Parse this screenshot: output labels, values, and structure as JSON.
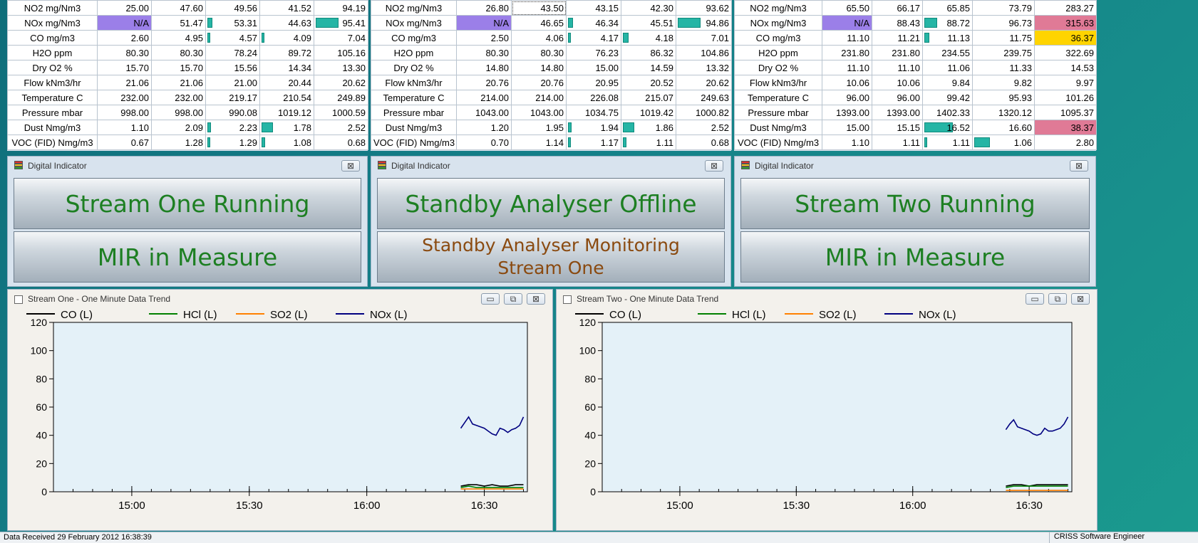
{
  "tables": [
    {
      "rows": [
        {
          "label": "NO2 mg/Nm3",
          "values": [
            "25.00",
            "47.60",
            "49.56",
            "41.52",
            "94.19"
          ]
        },
        {
          "label": "NOx mg/Nm3",
          "values": [
            "N/A",
            "51.47",
            "53.31",
            "44.63",
            "95.41"
          ]
        },
        {
          "label": "CO mg/m3",
          "values": [
            "2.60",
            "4.95",
            "4.57",
            "4.09",
            "7.04"
          ]
        },
        {
          "label": "H2O ppm",
          "values": [
            "80.30",
            "80.30",
            "78.24",
            "89.72",
            "105.16"
          ]
        },
        {
          "label": "Dry O2 %",
          "values": [
            "15.70",
            "15.70",
            "15.56",
            "14.34",
            "13.30"
          ]
        },
        {
          "label": "Flow kNm3/hr",
          "values": [
            "21.06",
            "21.06",
            "21.00",
            "20.44",
            "20.62"
          ]
        },
        {
          "label": "Temperature C",
          "values": [
            "232.00",
            "232.00",
            "219.17",
            "210.54",
            "249.89"
          ]
        },
        {
          "label": "Pressure mbar",
          "values": [
            "998.00",
            "998.00",
            "990.08",
            "1019.12",
            "1000.59"
          ]
        },
        {
          "label": "Dust Nmg/m3",
          "values": [
            "1.10",
            "2.09",
            "2.23",
            "1.78",
            "2.52"
          ]
        },
        {
          "label": "VOC (FID) Nmg/m3",
          "values": [
            "0.67",
            "1.28",
            "1.29",
            "1.08",
            "0.68"
          ]
        }
      ]
    },
    {
      "rows": [
        {
          "label": "NO2 mg/Nm3",
          "values": [
            "26.80",
            "43.50",
            "43.15",
            "42.30",
            "93.62"
          ]
        },
        {
          "label": "NOx mg/Nm3",
          "values": [
            "N/A",
            "46.65",
            "46.34",
            "45.51",
            "94.86"
          ]
        },
        {
          "label": "CO mg/m3",
          "values": [
            "2.50",
            "4.06",
            "4.17",
            "4.18",
            "7.01"
          ]
        },
        {
          "label": "H2O ppm",
          "values": [
            "80.30",
            "80.30",
            "76.23",
            "86.32",
            "104.86"
          ]
        },
        {
          "label": "Dry O2 %",
          "values": [
            "14.80",
            "14.80",
            "15.00",
            "14.59",
            "13.32"
          ]
        },
        {
          "label": "Flow kNm3/hr",
          "values": [
            "20.76",
            "20.76",
            "20.95",
            "20.52",
            "20.62"
          ]
        },
        {
          "label": "Temperature C",
          "values": [
            "214.00",
            "214.00",
            "226.08",
            "215.07",
            "249.63"
          ]
        },
        {
          "label": "Pressure mbar",
          "values": [
            "1043.00",
            "1043.00",
            "1034.75",
            "1019.42",
            "1000.82"
          ]
        },
        {
          "label": "Dust Nmg/m3",
          "values": [
            "1.20",
            "1.95",
            "1.94",
            "1.86",
            "2.52"
          ]
        },
        {
          "label": "VOC (FID) Nmg/m3",
          "values": [
            "0.70",
            "1.14",
            "1.17",
            "1.11",
            "0.68"
          ]
        }
      ]
    },
    {
      "rows": [
        {
          "label": "NO2 mg/Nm3",
          "values": [
            "65.50",
            "66.17",
            "65.85",
            "73.79",
            "283.27"
          ]
        },
        {
          "label": "NOx mg/Nm3",
          "values": [
            "N/A",
            "88.43",
            "88.72",
            "96.73",
            "315.63"
          ]
        },
        {
          "label": "CO mg/m3",
          "values": [
            "11.10",
            "11.21",
            "11.13",
            "11.75",
            "36.37"
          ]
        },
        {
          "label": "H2O ppm",
          "values": [
            "231.80",
            "231.80",
            "234.55",
            "239.75",
            "322.69"
          ]
        },
        {
          "label": "Dry O2 %",
          "values": [
            "11.10",
            "11.10",
            "11.06",
            "11.33",
            "14.53"
          ]
        },
        {
          "label": "Flow kNm3/hr",
          "values": [
            "10.06",
            "10.06",
            "9.84",
            "9.82",
            "9.97"
          ]
        },
        {
          "label": "Temperature C",
          "values": [
            "96.00",
            "96.00",
            "99.42",
            "95.93",
            "101.26"
          ]
        },
        {
          "label": "Pressure mbar",
          "values": [
            "1393.00",
            "1393.00",
            "1402.33",
            "1320.12",
            "1095.37"
          ]
        },
        {
          "label": "Dust Nmg/m3",
          "values": [
            "15.00",
            "15.15",
            "16.52",
            "16.60",
            "38.37"
          ]
        },
        {
          "label": "VOC (FID) Nmg/m3",
          "values": [
            "1.10",
            "1.11",
            "1.11",
            "1.06",
            "2.80"
          ]
        }
      ]
    }
  ],
  "indicators": [
    {
      "title": "Digital Indicator",
      "close": "⊠",
      "top": "Stream One Running",
      "bottom": "MIR in Measure"
    },
    {
      "title": "Digital Indicator",
      "close": "⊠",
      "top": "Standby Analyser Offline",
      "bottom": "Standby Analyser Monitoring Stream One"
    },
    {
      "title": "Digital Indicator",
      "close": "⊠",
      "top": "Stream Two Running",
      "bottom": "MIR in Measure"
    }
  ],
  "charts": [
    {
      "title": "Stream One - One Minute Data Trend",
      "btn_min": "▭",
      "btn_max": "⧉",
      "btn_close": "⊠"
    },
    {
      "title": "Stream Two - One Minute Data Trend",
      "btn_min": "▭",
      "btn_max": "⧉",
      "btn_close": "⊠"
    }
  ],
  "chart_data": [
    {
      "type": "line",
      "ylim": [
        0,
        120
      ],
      "yticks": [
        "0",
        "20",
        "40",
        "60",
        "80",
        "100",
        "120"
      ],
      "xticks": [
        "15:00",
        "15:30",
        "16:00",
        "16:30"
      ],
      "xtick_minutes": [
        900,
        930,
        960,
        990
      ],
      "xlim_minutes": [
        880,
        1001
      ],
      "series": [
        {
          "name": "CO (L)",
          "color": "#000000",
          "x": [
            984,
            986,
            988,
            990,
            992,
            994,
            996,
            998,
            1000
          ],
          "values": [
            4,
            5,
            5,
            4,
            5,
            4,
            4,
            5,
            5
          ]
        },
        {
          "name": "HCl (L)",
          "color": "#008000",
          "x": [
            984,
            986,
            988,
            990,
            992,
            994,
            996,
            998,
            1000
          ],
          "values": [
            3,
            4,
            3,
            3,
            3,
            3,
            3,
            3,
            3
          ]
        },
        {
          "name": "SO2 (L)",
          "color": "#ff8000",
          "x": [
            984,
            986,
            988,
            990,
            992,
            994,
            996,
            998,
            1000
          ],
          "values": [
            2,
            2,
            2,
            2,
            2,
            2,
            2,
            2,
            2
          ]
        },
        {
          "name": "NOx (L)",
          "color": "#000080",
          "x": [
            984,
            985,
            986,
            987,
            988,
            989,
            990,
            991,
            992,
            993,
            994,
            995,
            996,
            997,
            998,
            999,
            1000
          ],
          "values": [
            45,
            49,
            53,
            48,
            47,
            46,
            45,
            43,
            41,
            40,
            45,
            44,
            42,
            44,
            45,
            47,
            53
          ]
        }
      ]
    },
    {
      "type": "line",
      "ylim": [
        0,
        120
      ],
      "yticks": [
        "0",
        "20",
        "40",
        "60",
        "80",
        "100",
        "120"
      ],
      "xticks": [
        "15:00",
        "15:30",
        "16:00",
        "16:30"
      ],
      "xtick_minutes": [
        900,
        930,
        960,
        990
      ],
      "xlim_minutes": [
        880,
        1001
      ],
      "series": [
        {
          "name": "CO (L)",
          "color": "#000000",
          "x": [
            984,
            986,
            988,
            990,
            992,
            994,
            996,
            998,
            1000
          ],
          "values": [
            4,
            5,
            5,
            4,
            5,
            5,
            5,
            5,
            5
          ]
        },
        {
          "name": "HCl (L)",
          "color": "#008000",
          "x": [
            984,
            986,
            988,
            990,
            992,
            994,
            996,
            998,
            1000
          ],
          "values": [
            3,
            4,
            4,
            4,
            4,
            4,
            4,
            4,
            4
          ]
        },
        {
          "name": "SO2 (L)",
          "color": "#ff8000",
          "x": [
            984,
            986,
            988,
            990,
            992,
            994,
            996,
            998,
            1000
          ],
          "values": [
            1,
            1,
            1,
            1,
            1,
            1,
            1,
            1,
            1
          ]
        },
        {
          "name": "NOx (L)",
          "color": "#000080",
          "x": [
            984,
            985,
            986,
            987,
            988,
            989,
            990,
            991,
            992,
            993,
            994,
            995,
            996,
            997,
            998,
            999,
            1000
          ],
          "values": [
            44,
            48,
            51,
            46,
            45,
            44,
            43,
            41,
            40,
            41,
            45,
            43,
            43,
            44,
            45,
            48,
            53
          ]
        }
      ]
    }
  ],
  "status": {
    "left": "Data Received 29 February 2012 16:38:39",
    "right": "CRISS Software Engineer"
  }
}
